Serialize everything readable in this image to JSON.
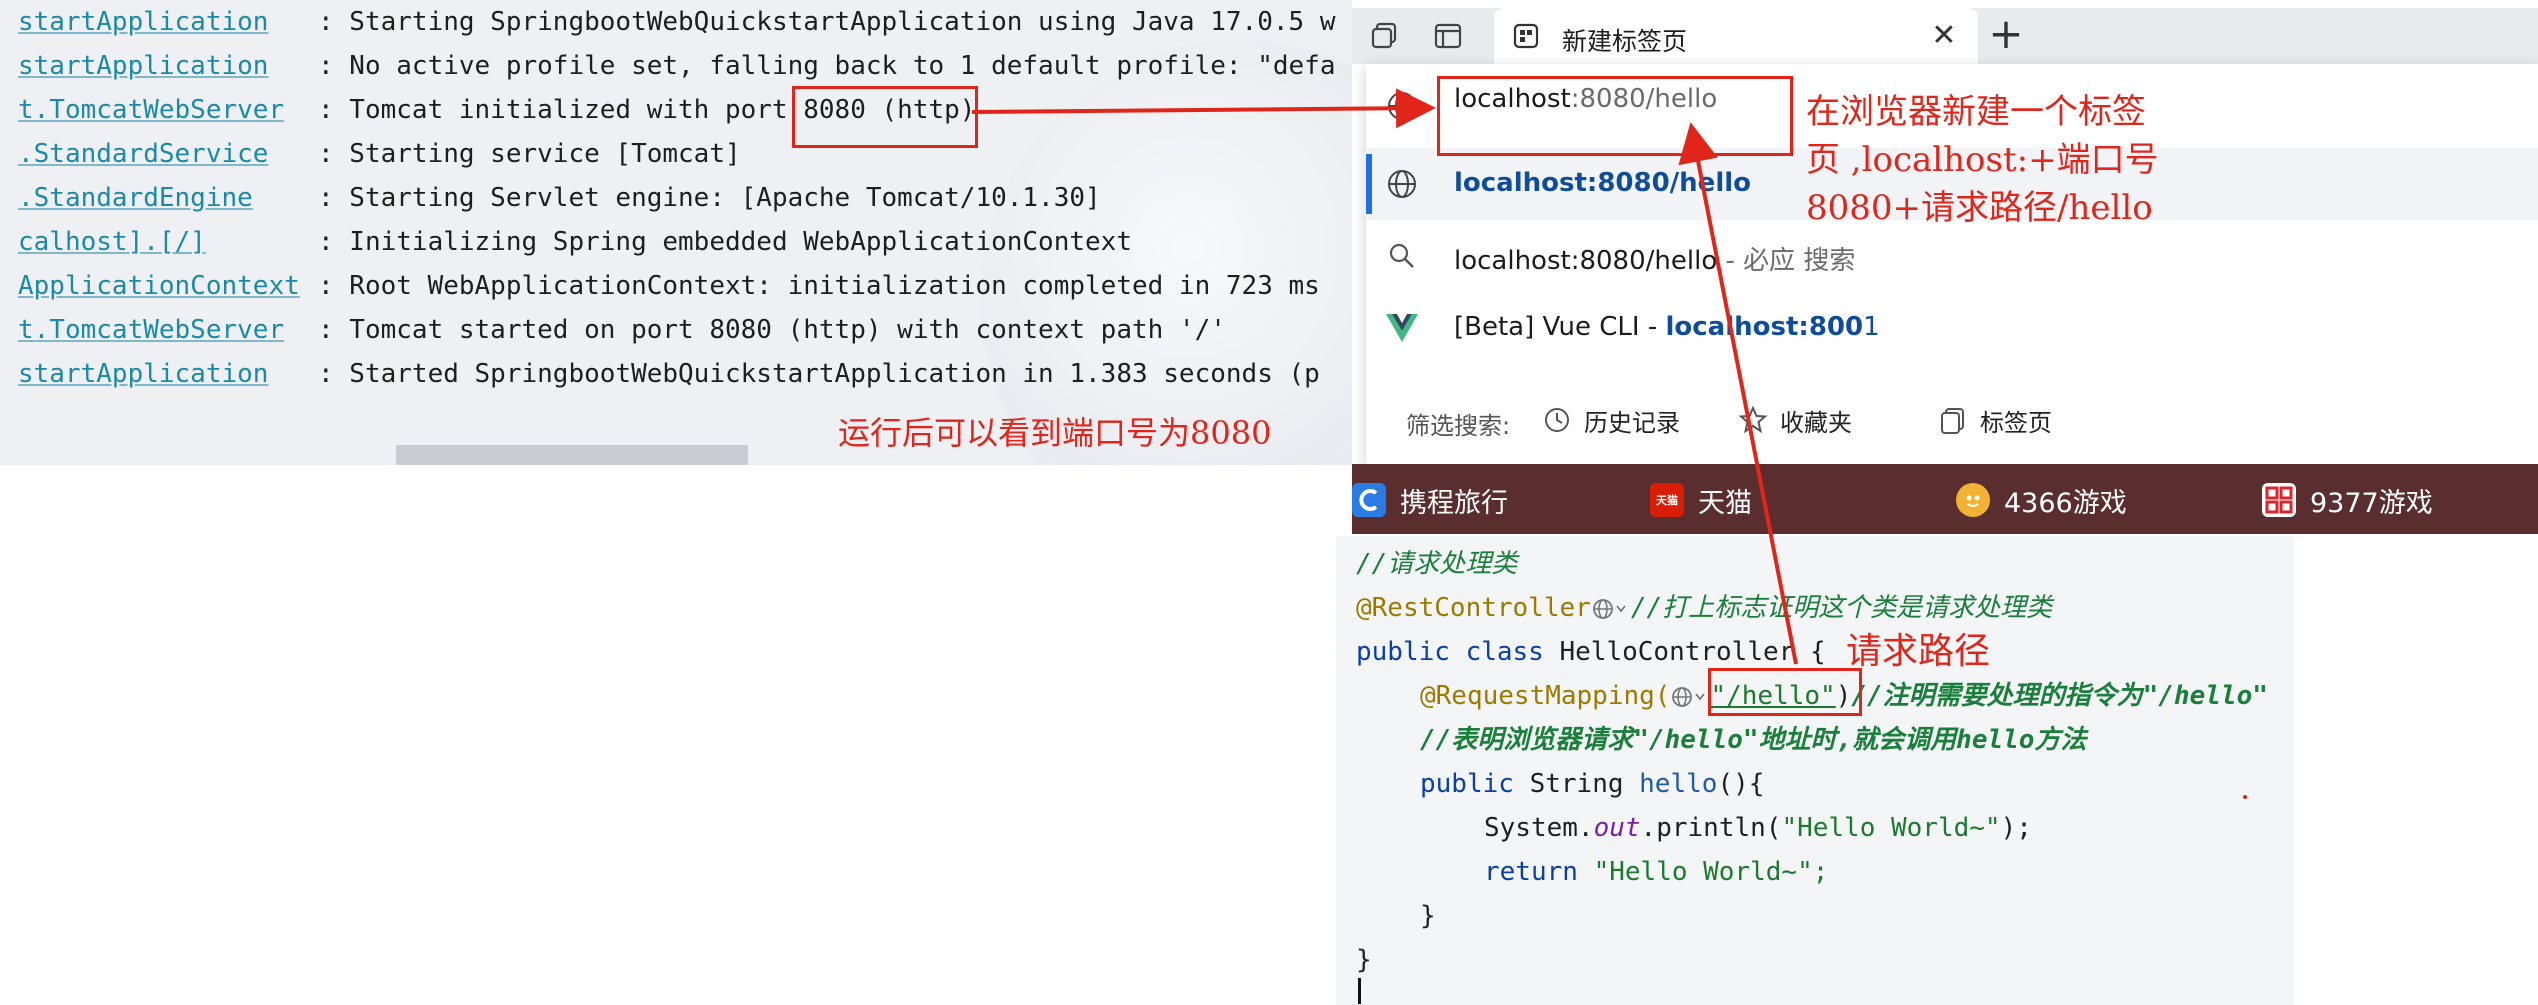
{
  "console": {
    "lines": [
      {
        "logger": "startApplication",
        "message": ": Starting SpringbootWebQuickstartApplication using Java 17.0.5 w"
      },
      {
        "logger": "startApplication",
        "message": ": No active profile set, falling back to 1 default profile: \"defa"
      },
      {
        "logger": "t.TomcatWebServer",
        "message": ": Tomcat initialized with port 8080 (http)"
      },
      {
        "logger": ".StandardService",
        "message": ": Starting service [Tomcat]"
      },
      {
        "logger": ".StandardEngine",
        "message": ": Starting Servlet engine: [Apache Tomcat/10.1.30]"
      },
      {
        "logger": "calhost].[/]",
        "message": ": Initializing Spring embedded WebApplicationContext"
      },
      {
        "logger": "ApplicationContext",
        "message": ": Root WebApplicationContext: initialization completed in 723 ms"
      },
      {
        "logger": "t.TomcatWebServer",
        "message": ": Tomcat started on port 8080 (http) with context path '/'"
      },
      {
        "logger": "startApplication",
        "message": ": Started SpringbootWebQuickstartApplication in 1.383 seconds (p"
      }
    ],
    "annotation": "运行后可以看到端口号为8080"
  },
  "browser": {
    "tab_title": "新建标签页",
    "address": {
      "typed": "localhost",
      "suggested": ":8080/hello"
    },
    "suggestions": [
      {
        "text": "localhost:8080/hello"
      },
      {
        "text": "localhost:8080/hello",
        "suffix": " - 必应 搜索"
      },
      {
        "prefix": "[Beta] Vue CLI - ",
        "highlight": "localhost:800",
        "rest": "1"
      }
    ],
    "filter": {
      "label": "筛选搜索:",
      "chips": [
        "历史记录",
        "收藏夹",
        "标签页"
      ]
    },
    "bookmarks": [
      {
        "label": "携程旅行",
        "icon": "ctrip-icon",
        "color": "#2a7be4"
      },
      {
        "label": "天猫",
        "icon": "tmall-icon",
        "icon_text": "天猫",
        "color": "#d81e06"
      },
      {
        "label": "4366游戏",
        "icon": "4366-icon",
        "color": "#f2b233"
      },
      {
        "label": "9377游戏",
        "icon": "9377-icon",
        "color": "#d8262a"
      }
    ],
    "annotation": {
      "line1": "在浏览器新建一个标签",
      "line2": "页 ,localhost:+端口号",
      "line3": "8080+请求路径/hello"
    }
  },
  "editor": {
    "comment1": "//请求处理类",
    "rest_controller": "@RestController",
    "comment2": "//打上标志证明这个类是请求处理类",
    "class_kw": "public class",
    "class_name": " HelloController {",
    "request_mapping": "@RequestMapping(",
    "mapping_path": "\"/hello\"",
    "close_paren": ")",
    "comment3": "//注明需要处理的指令为\"/hello\"",
    "comment4": "//表明浏览器请求\"/hello\"地址时,就会调用hello方法",
    "method_kw": "public",
    "method_sig": " String ",
    "method_name": "hello",
    "method_tail": "(){",
    "println_pre": "System.",
    "println_field": "out",
    "println_post": ".println(",
    "println_arg": "\"Hello World~\"",
    "println_end": ");",
    "return_kw": "return",
    "return_val": " \"Hello World~\";",
    "brace_method": "}",
    "brace_class": "}",
    "annotation": "请求路径"
  }
}
